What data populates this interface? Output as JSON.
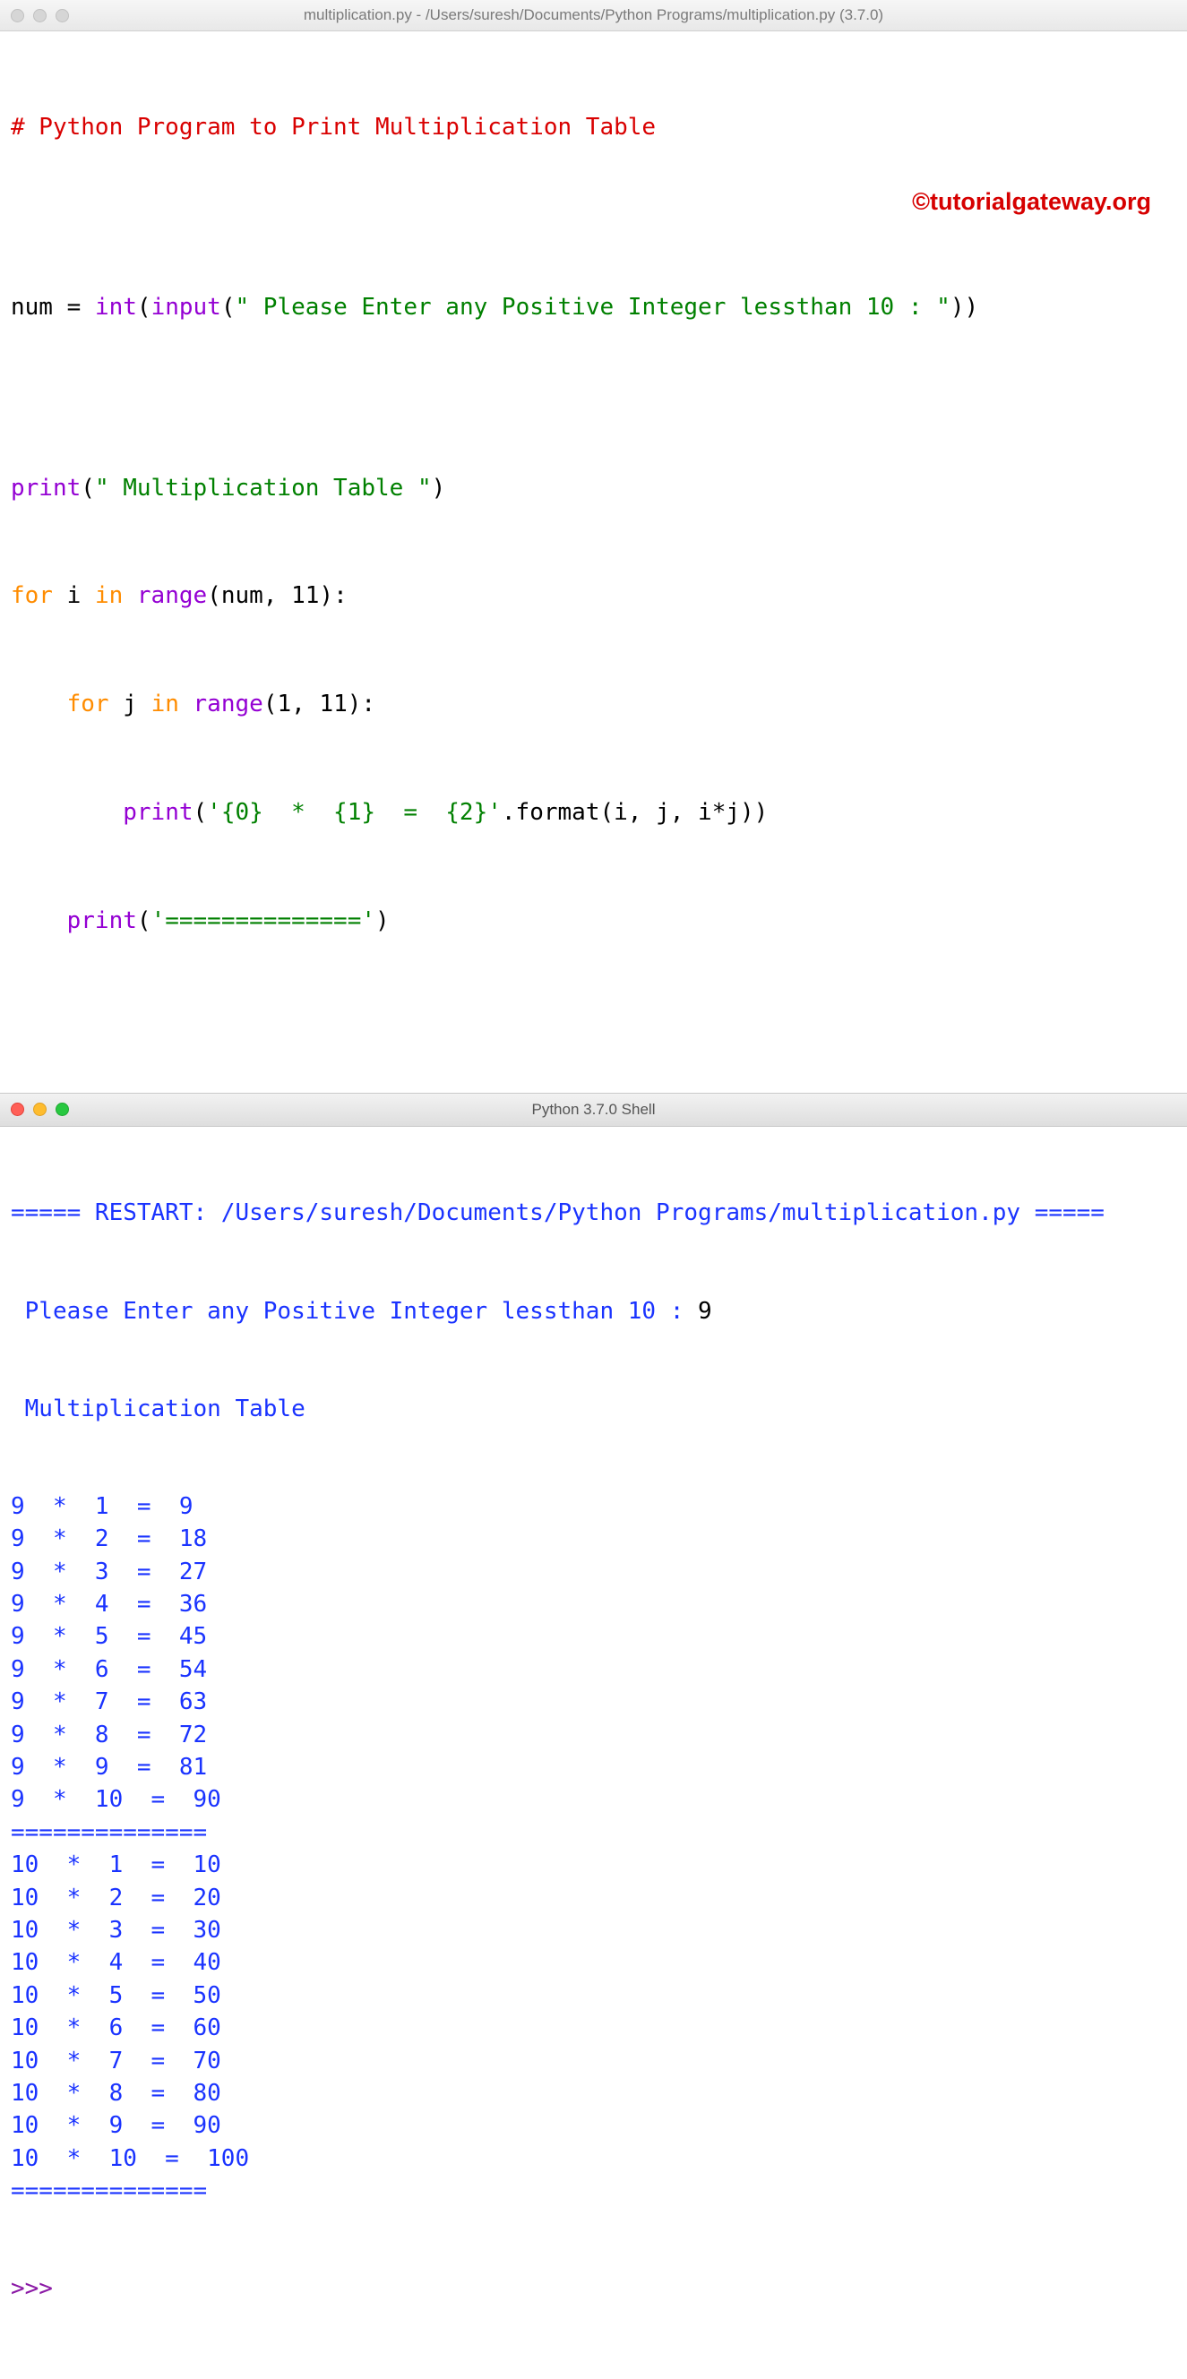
{
  "editor_window": {
    "title": "multiplication.py - /Users/suresh/Documents/Python Programs/multiplication.py (3.7.0)",
    "code": {
      "l1": {
        "comment": "# Python Program to Print Multiplication Table"
      },
      "l2": "",
      "l3": {
        "a": "num ",
        "b": "=",
        "c": " ",
        "d": "int",
        "e": "(",
        "f": "input",
        "g": "(",
        "h": "\" Please Enter any Positive Integer lessthan 10 : \"",
        "i": "))"
      },
      "l4": "",
      "l5": {
        "a": "print",
        "b": "(",
        "c": "\" Multiplication Table \"",
        "d": ")"
      },
      "l6": {
        "a": "for",
        "b": " i ",
        "c": "in",
        "d": " ",
        "e": "range",
        "f": "(num, ",
        "g": "11",
        "h": "):"
      },
      "l7": {
        "a": "    ",
        "b": "for",
        "c": " j ",
        "d": "in",
        "e": " ",
        "f": "range",
        "g": "(",
        "h": "1",
        "i": ", ",
        "j": "11",
        "k": "):"
      },
      "l8": {
        "a": "        ",
        "b": "print",
        "c": "(",
        "d": "'{0}  *  {1}  =  {2}'",
        "e": ".format(i, j, i",
        "f": "*",
        "g": "j))"
      },
      "l9": {
        "a": "    ",
        "b": "print",
        "c": "(",
        "d": "'=============='",
        "e": ")"
      }
    },
    "watermark": "©tutorialgateway.org"
  },
  "shell_window": {
    "title": "Python 3.7.0 Shell",
    "restart": "===== RESTART: /Users/suresh/Documents/Python Programs/multiplication.py =====",
    "prompt_label": " Please Enter any Positive Integer lessthan 10 : ",
    "user_input": "9",
    "header": " Multiplication Table ",
    "rows": [
      "9  *  1  =  9",
      "9  *  2  =  18",
      "9  *  3  =  27",
      "9  *  4  =  36",
      "9  *  5  =  45",
      "9  *  6  =  54",
      "9  *  7  =  63",
      "9  *  8  =  72",
      "9  *  9  =  81",
      "9  *  10  =  90",
      "==============",
      "10  *  1  =  10",
      "10  *  2  =  20",
      "10  *  3  =  30",
      "10  *  4  =  40",
      "10  *  5  =  50",
      "10  *  6  =  60",
      "10  *  7  =  70",
      "10  *  8  =  80",
      "10  *  9  =  90",
      "10  *  10  =  100",
      "=============="
    ],
    "cursor": ">>> "
  }
}
